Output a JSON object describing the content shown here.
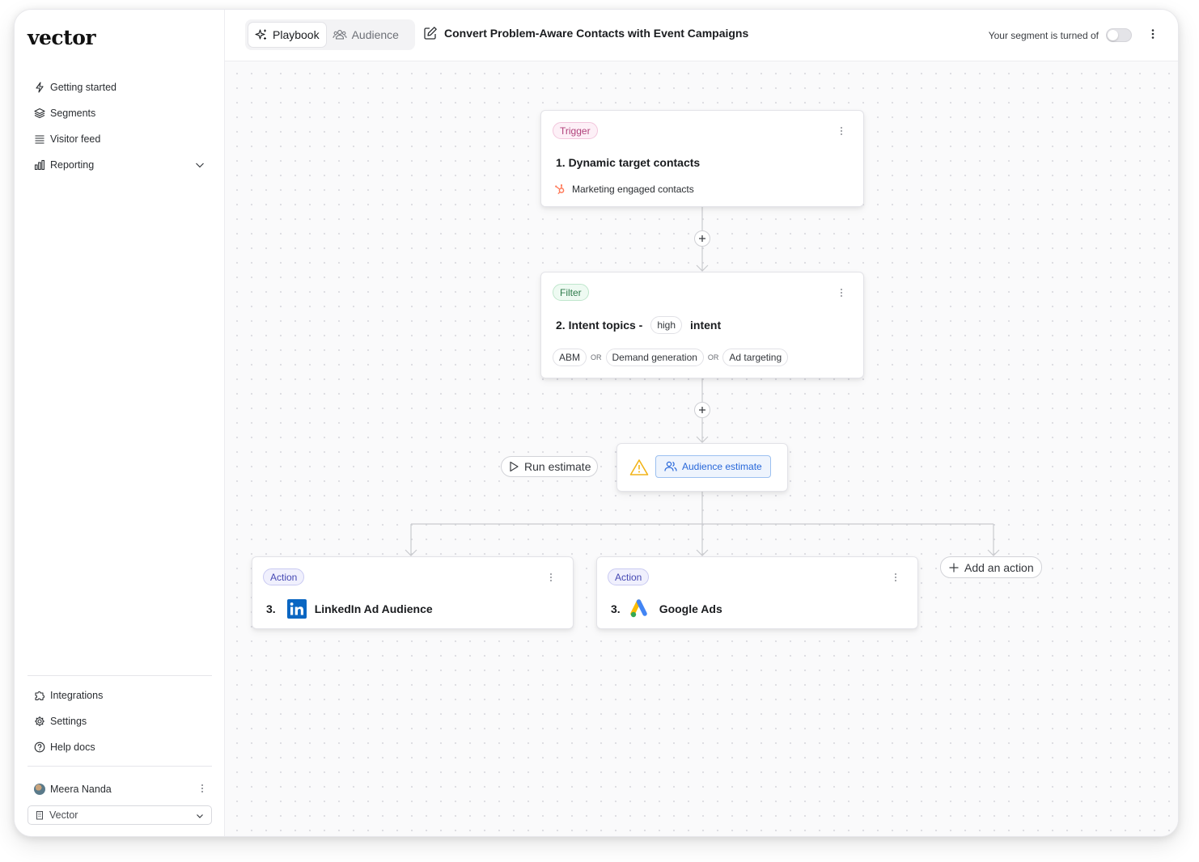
{
  "app": {
    "logo": "vector"
  },
  "sidebar": {
    "top_items": [
      {
        "label": "Getting started",
        "icon": "bolt-icon"
      },
      {
        "label": "Segments",
        "icon": "layers-icon"
      },
      {
        "label": "Visitor feed",
        "icon": "list-icon"
      },
      {
        "label": "Reporting",
        "icon": "bar-chart-icon"
      }
    ],
    "bottom_items": [
      {
        "label": "Integrations",
        "icon": "puzzle-icon"
      },
      {
        "label": "Settings",
        "icon": "gear-icon"
      },
      {
        "label": "Help docs",
        "icon": "help-circle-icon"
      }
    ],
    "user": {
      "name": "Meera Nanda"
    },
    "org": {
      "selected": "Vector"
    }
  },
  "header": {
    "tabs": [
      {
        "label": "Playbook",
        "active": true
      },
      {
        "label": "Audience",
        "active": false
      }
    ],
    "title": "Convert Problem-Aware Contacts with Event Campaigns",
    "segment_status": "Your segment is turned of",
    "segment_enabled": false
  },
  "flow": {
    "trigger": {
      "badge": "Trigger",
      "title": "1. Dynamic target contacts",
      "source": "Marketing engaged contacts"
    },
    "filter": {
      "badge": "Filter",
      "title_prefix": "2. Intent topics -",
      "level": "high",
      "title_suffix": "intent",
      "topics": [
        "ABM",
        "Demand generation",
        "Ad targeting"
      ],
      "connector": "OR"
    },
    "run_estimate_label": "Run estimate",
    "audience_estimate_label": "Audience estimate",
    "actions": [
      {
        "badge": "Action",
        "number": "3.",
        "name": "LinkedIn Ad Audience"
      },
      {
        "badge": "Action",
        "number": "3.",
        "name": "Google Ads"
      }
    ],
    "add_action_label": "Add an action"
  },
  "colors": {
    "trigger": "#b0417a",
    "filter": "#2d7a4a",
    "action": "#4548b3",
    "estimate": "#2767d9",
    "warning": "#f4b400",
    "linkedin": "#0a66c2"
  }
}
